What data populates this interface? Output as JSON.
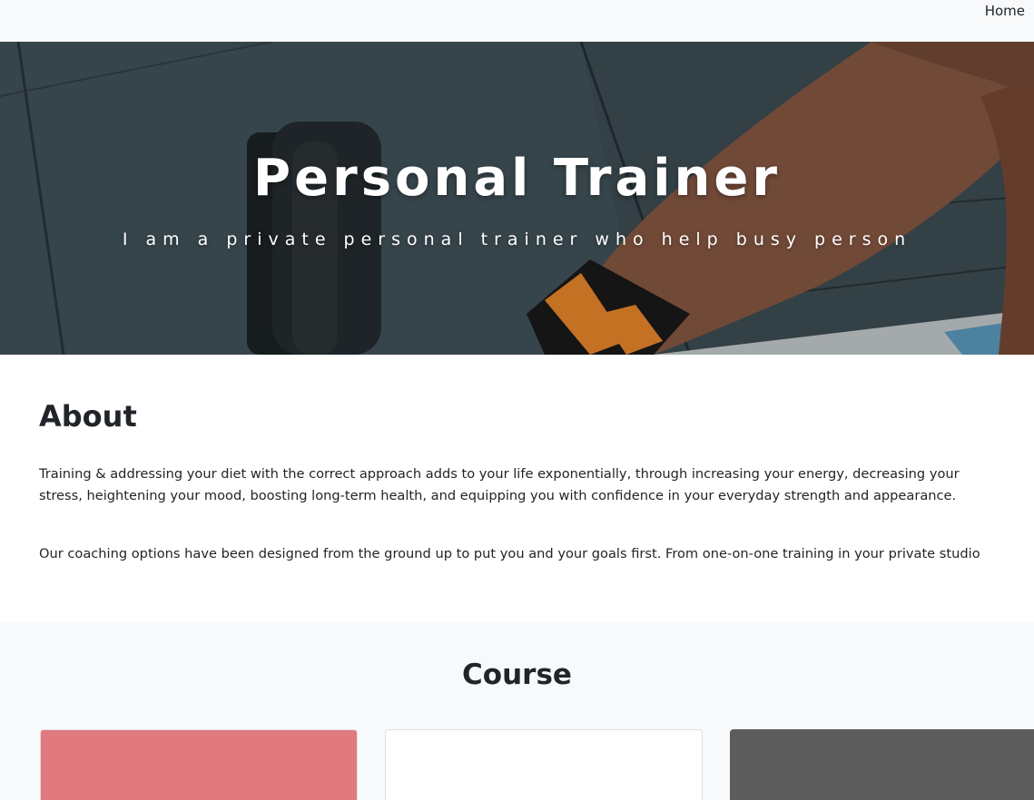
{
  "nav": {
    "home_label": "Home"
  },
  "hero": {
    "title": "Personal Trainer",
    "subtitle": "I am a private personal trainer who help busy person"
  },
  "about": {
    "title": "About",
    "paragraph_1": "Training & addressing your diet with the correct approach adds to your life exponentially, through increasing your energy, decreasing your stress, heightening your mood, boosting long-term health, and equipping you with confidence in your everyday strength and appearance.",
    "paragraph_2": "Our coaching options have been designed from the ground up to put you and your goals first. From one-on-one training in your private studio"
  },
  "course": {
    "title": "Course",
    "cards": [
      {
        "color": "#e07a7f"
      },
      {
        "color": "#ffffff"
      },
      {
        "color": "#5c5c5c"
      }
    ]
  },
  "colors": {
    "navbar_bg": "#f8f9fa",
    "section_bg": "#f8f9fa",
    "text": "#212529"
  }
}
